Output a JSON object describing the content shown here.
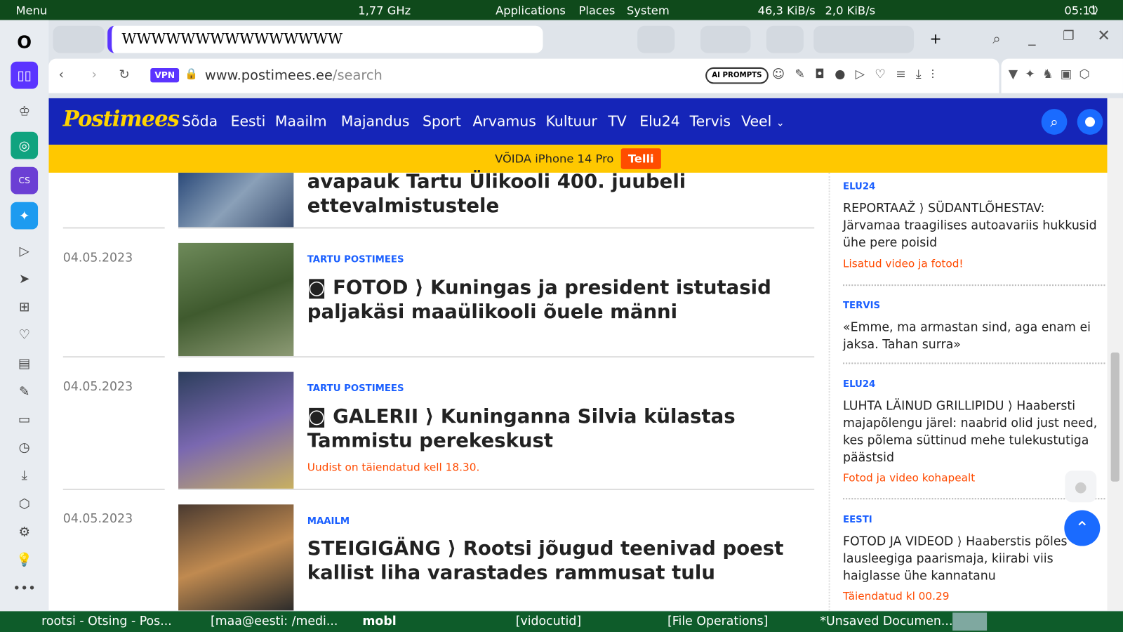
{
  "system_panel": {
    "menu": "Menu",
    "cpu": "1,77 GHz",
    "applications": "Applications",
    "places": "Places",
    "system": "System",
    "down": "46,3 KiB/s",
    "up": "2,0 KiB/s",
    "clock": "05:11"
  },
  "browser": {
    "url_host": "www.postimees.ee",
    "url_path": "/search",
    "vpn": "VPN",
    "ai_prompts": "AI PROMPTS"
  },
  "site": {
    "logo": "Postimees",
    "nav": [
      "Sõda",
      "Eesti",
      "Maailm",
      "Majandus",
      "Sport",
      "Arvamus",
      "Kultuur",
      "TV",
      "Elu24",
      "Tervis",
      "Veel"
    ],
    "banner_text": "VÕIDA iPhone 14 Pro",
    "banner_button": "Telli"
  },
  "articles": [
    {
      "title": "avapauk Tartu Ülikooli 400. juubeli ettevalmistustele"
    },
    {
      "date": "04.05.2023",
      "category": "TARTU POSTIMEES",
      "title": "FOTOD ⟩ Kuningas ja president istutasid paljakäsi maaülikooli õuele männi"
    },
    {
      "date": "04.05.2023",
      "category": "TARTU POSTIMEES",
      "title": "GALERII ⟩ Kuninganna Silvia külastas Tammistu perekeskust",
      "subtitle": "Uudist on täiendatud kell 18.30."
    },
    {
      "date": "04.05.2023",
      "category": "MAAILM",
      "title": "STEIGIGÄNG ⟩ Rootsi jõugud teenivad poest kallist liha varastades rammusat tulu"
    }
  ],
  "sidebar_articles": [
    {
      "category": "ELU24",
      "title": "REPORTAAŽ ⟩ SÜDANTLÕHESTAV: Järvamaa traagilises autoavariis hukkusid ühe pere poisid",
      "subtitle": "Lisatud video ja fotod!"
    },
    {
      "category": "TERVIS",
      "title": "«Emme, ma armastan sind, aga enam ei jaksa. Tahan surra»"
    },
    {
      "category": "ELU24",
      "title": "LUHTA LÄINUD GRILLIPIDU ⟩ Haabersti majapõlengu järel: naabrid olid just need, kes põlema süttinud mehe tulekustutiga päästsid",
      "subtitle": "Fotod ja video kohapealt"
    },
    {
      "category": "EESTI",
      "title": "FOTOD JA VIDEOD ⟩ Haaberstis põles lausleegiga paarismaja, kiirabi viis haiglasse ühe kannatanu",
      "subtitle": "Täiendatud kl 00.29"
    }
  ],
  "taskbar": [
    "rootsi - Otsing - Pos...",
    "[maa@eesti: /medi...",
    "mobl",
    "[vidocutid]",
    "[File Operations]",
    "*Unsaved Documen..."
  ],
  "colors": {
    "nav": "#1525b8",
    "banner": "#ffc800",
    "accent": "#1a5fff",
    "highlight": "#ff4a00"
  }
}
